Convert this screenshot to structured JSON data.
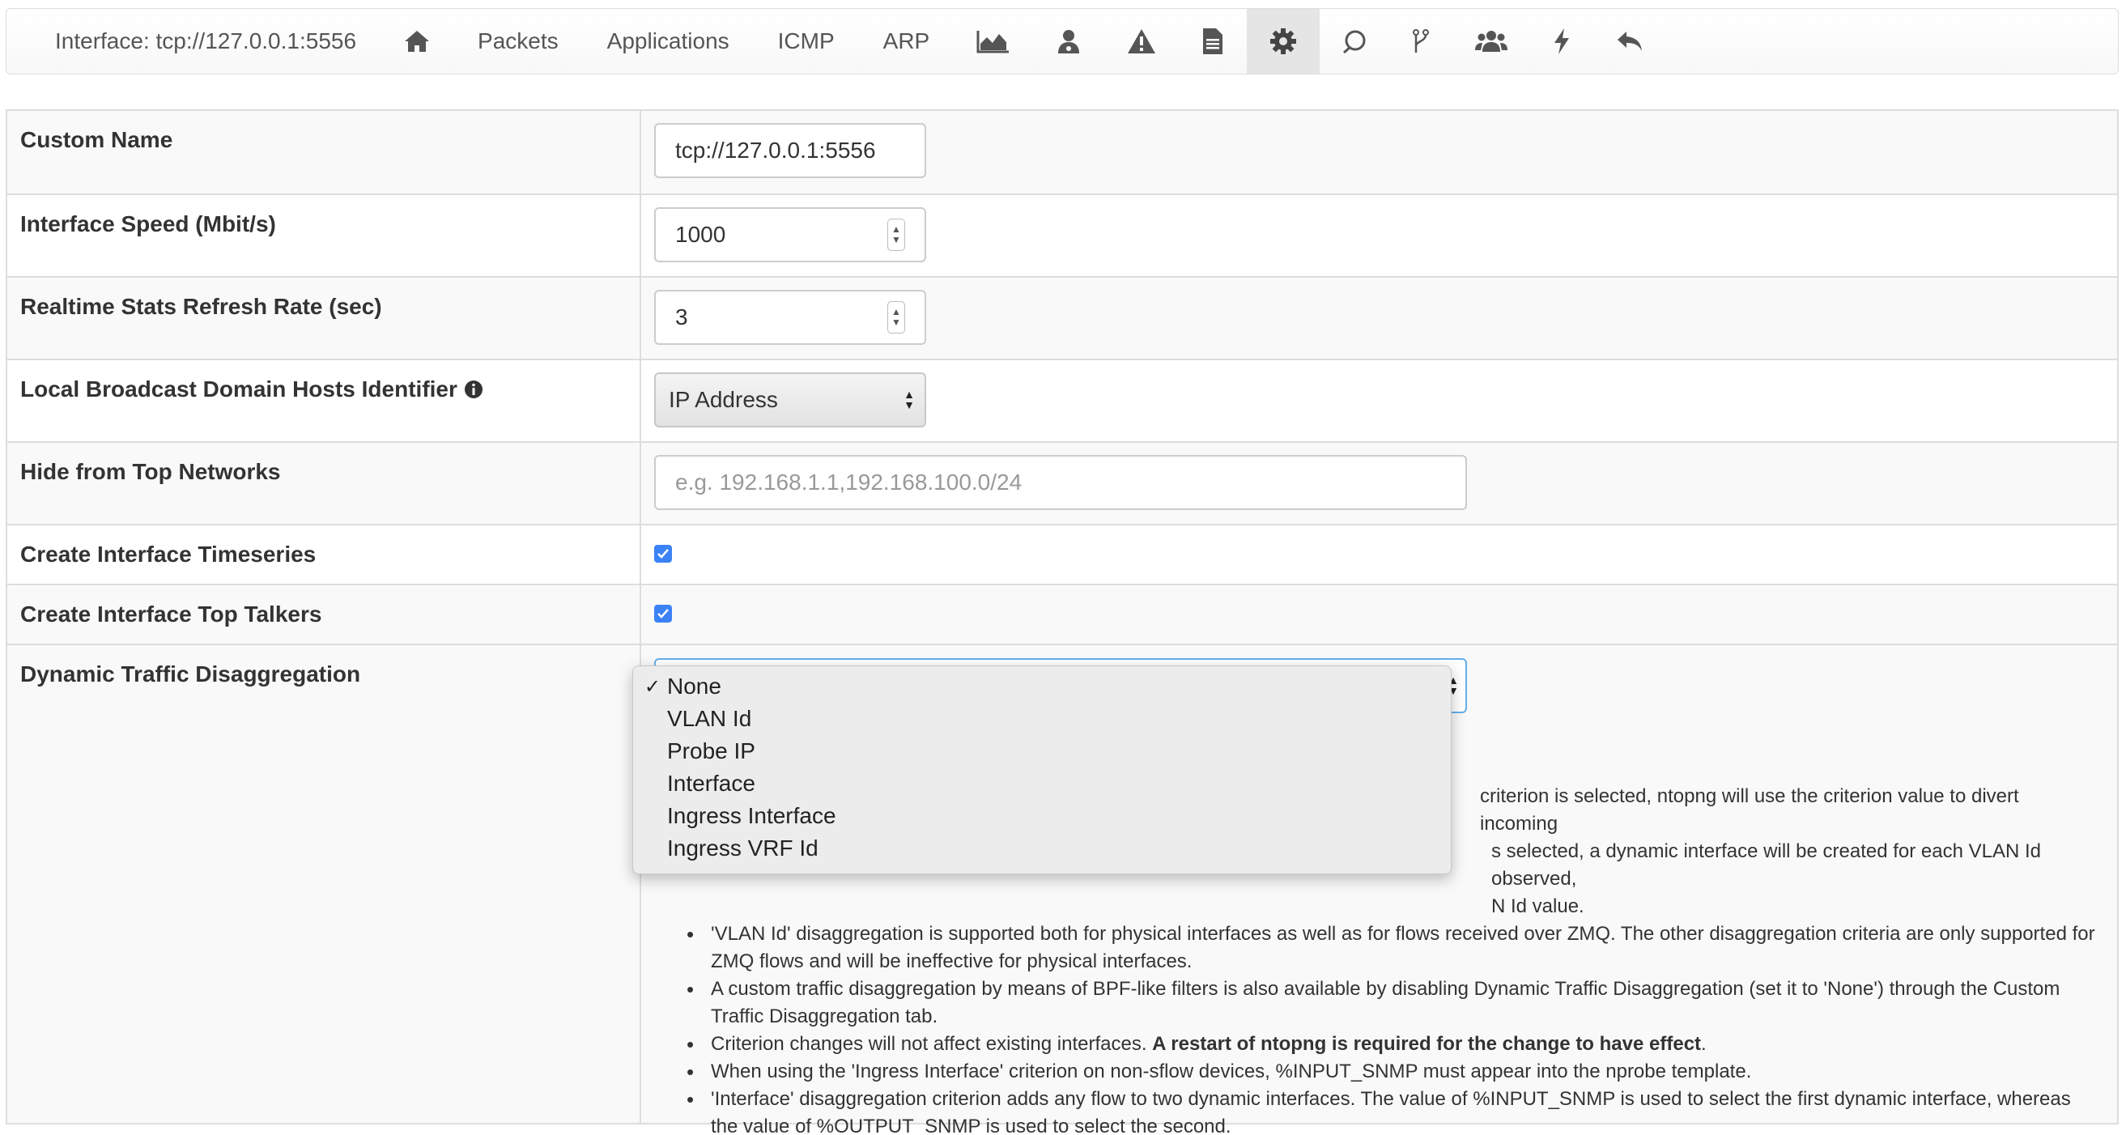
{
  "nav": {
    "title": "Interface: tcp://127.0.0.1:5556",
    "links": [
      "Packets",
      "Applications",
      "ICMP",
      "ARP"
    ],
    "icons": [
      "home-icon",
      "area-chart-icon",
      "user-secret-icon",
      "warning-icon",
      "file-icon",
      "gear-icon",
      "circle-arrow-icon",
      "code-fork-icon",
      "users-icon",
      "bolt-icon",
      "reply-icon"
    ],
    "active": "gear-icon"
  },
  "settings": {
    "custom_name": {
      "label": "Custom Name",
      "value": "tcp://127.0.0.1:5556"
    },
    "interface_speed": {
      "label": "Interface Speed (Mbit/s)",
      "value": "1000"
    },
    "refresh_rate": {
      "label": "Realtime Stats Refresh Rate (sec)",
      "value": "3"
    },
    "broadcast_identifier": {
      "label": "Local Broadcast Domain Hosts Identifier",
      "value": "IP Address"
    },
    "hide_top_networks": {
      "label": "Hide from Top Networks",
      "placeholder": "e.g. 192.168.1.1,192.168.100.0/24"
    },
    "create_timeseries": {
      "label": "Create Interface Timeseries",
      "checked": true
    },
    "create_top_talkers": {
      "label": "Create Interface Top Talkers",
      "checked": true
    },
    "disaggregation": {
      "label": "Dynamic Traffic Disaggregation",
      "selected": "None",
      "options": [
        "None",
        "VLAN Id",
        "Probe IP",
        "Interface",
        "Ingress Interface",
        "Ingress VRF Id"
      ],
      "note_fragments": [
        "criterion is selected, ntopng will use the criterion value to divert incoming",
        "s selected, a dynamic interface will be created for each VLAN Id observed,",
        "N Id value."
      ],
      "bullets": [
        "'VLAN Id' disaggregation is supported both for physical interfaces as well as for flows received over ZMQ. The other disaggregation criteria are only supported for ZMQ flows and will be ineffective for physical interfaces.",
        "A custom traffic disaggregation by means of BPF-like filters is also available by disabling Dynamic Traffic Disaggregation (set it to 'None') through the Custom Traffic Disaggregation tab.",
        "When using the 'Ingress Interface' criterion on non-sflow devices, %INPUT_SNMP must appear into the nprobe template.",
        "'Interface' disaggregation criterion adds any flow to two dynamic interfaces. The value of %INPUT_SNMP is used to select the first dynamic interface, whereas the value of %OUTPUT_SNMP is used to select the second."
      ],
      "restart_note": "Criterion changes will not affect existing interfaces. ",
      "restart_note_bold": "A restart of ntopng is required for the change to have effect",
      "restart_note_end": "."
    }
  },
  "colors": {
    "checkbox": "#3b82f6",
    "active_tab": "#e5e5e5",
    "focus_border": "#66afe9"
  }
}
